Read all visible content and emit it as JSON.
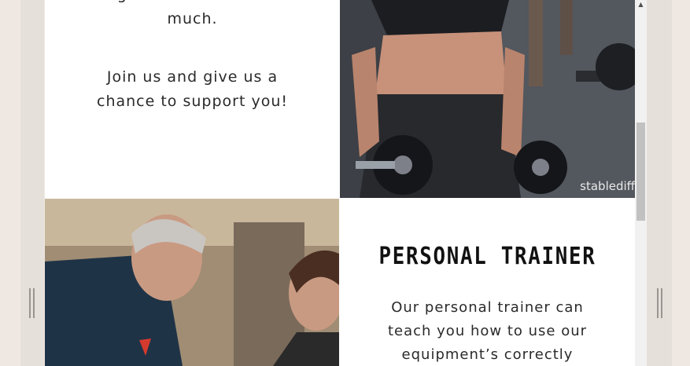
{
  "intro": {
    "line1": "together we can do so",
    "line2": "much.",
    "line3": "Join us and give us a",
    "line4": "chance to support you!"
  },
  "gym_photo": {
    "watermark": "stablediff"
  },
  "personal_trainer": {
    "heading": "PERSONAL TRAINER",
    "line1": "Our personal trainer can",
    "line2": "teach you how to use our",
    "line3": "equipment’s correctly"
  },
  "scrollbar": {
    "up_icon": "▲",
    "position_fraction": 0.34
  },
  "colors": {
    "page_bg": "#ffffff",
    "side_bg": "#efe8e2",
    "text": "#2a2a2a",
    "heading": "#111111"
  }
}
